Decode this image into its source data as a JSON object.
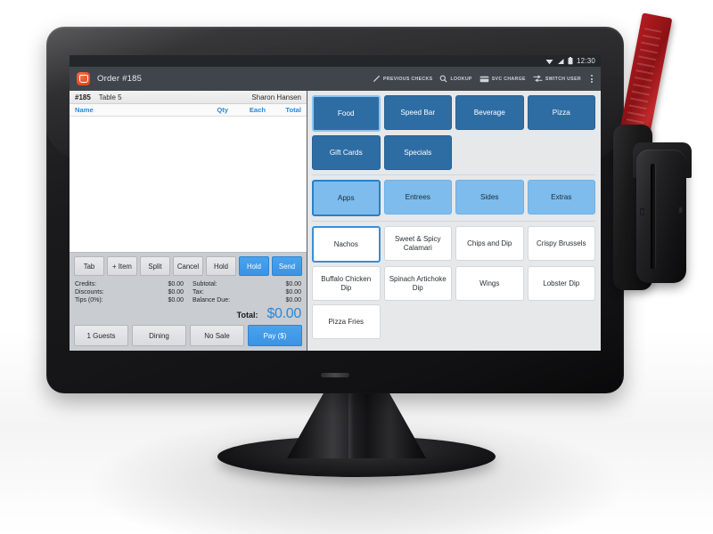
{
  "device": {
    "type": "all-in-one-pos-terminal",
    "peripheral": "magnetic-card-reader",
    "card_color": "#A81A1E"
  },
  "statusbar": {
    "time": "12:30",
    "icons": [
      "wifi-icon",
      "signal-icon",
      "battery-icon"
    ]
  },
  "appbar": {
    "logo": "app-logo-icon",
    "title": "Order #185",
    "tools": [
      {
        "label": "PREVIOUS CHECKS",
        "icon": "pencil-icon"
      },
      {
        "label": "LOOKUP",
        "icon": "search-icon"
      },
      {
        "label": "SVC CHARGE",
        "icon": "card-icon"
      },
      {
        "label": "SWITCH USER",
        "icon": "switch-arrows-icon"
      }
    ],
    "overflow": "kebab-menu-icon"
  },
  "order": {
    "number": "#185",
    "table": "Table 5",
    "server": "Sharon Hansen",
    "columns": [
      "Name",
      "Qty",
      "Each",
      "Total"
    ],
    "items": [],
    "actions": [
      "Tab",
      "+ Item",
      "Split",
      "Cancel",
      "Hold",
      "Hold",
      "Send"
    ],
    "totals_left": [
      {
        "label": "Credits:",
        "value": "$0.00"
      },
      {
        "label": "Discounts:",
        "value": "$0.00"
      },
      {
        "label": "Tips (0%):",
        "value": "$0.00"
      }
    ],
    "totals_right": [
      {
        "label": "Subtotal:",
        "value": "$0.00"
      },
      {
        "label": "Tax:",
        "value": "$0.00"
      },
      {
        "label": "Balance Due:",
        "value": "$0.00"
      }
    ],
    "grand_label": "Total:",
    "grand_value": "$0.00",
    "footer_actions": [
      "1 Guests",
      "Dining",
      "No Sale",
      "Pay ($)"
    ]
  },
  "menu": {
    "categories": [
      {
        "label": "Food",
        "selected": true
      },
      {
        "label": "Speed Bar",
        "selected": false
      },
      {
        "label": "Beverage",
        "selected": false
      },
      {
        "label": "Pizza",
        "selected": false
      },
      {
        "label": "Gift Cards",
        "selected": false
      },
      {
        "label": "Specials",
        "selected": false
      }
    ],
    "subcategories": [
      {
        "label": "Apps",
        "selected": true
      },
      {
        "label": "Entrees",
        "selected": false
      },
      {
        "label": "Sides",
        "selected": false
      },
      {
        "label": "Extras",
        "selected": false
      }
    ],
    "items": [
      {
        "label": "Nachos",
        "selected": true
      },
      {
        "label": "Sweet & Spicy Calamari",
        "selected": false
      },
      {
        "label": "Chips and Dip",
        "selected": false
      },
      {
        "label": "Crispy Brussels",
        "selected": false
      },
      {
        "label": "Buffalo Chicken Dip",
        "selected": false
      },
      {
        "label": "Spinach Artichoke Dip",
        "selected": false
      },
      {
        "label": "Wings",
        "selected": false
      },
      {
        "label": "Lobster Dip",
        "selected": false
      },
      {
        "label": "Pizza Fries",
        "selected": false
      }
    ]
  },
  "colors": {
    "accent_blue": "#2B88D8",
    "category_dark": "#2E6DA4",
    "category_light": "#7DBCED",
    "appbar": "#3F454B",
    "panel_gray": "#C9CCD1",
    "menu_bg": "#E6E8EA",
    "logo_orange": "#E8481F"
  }
}
